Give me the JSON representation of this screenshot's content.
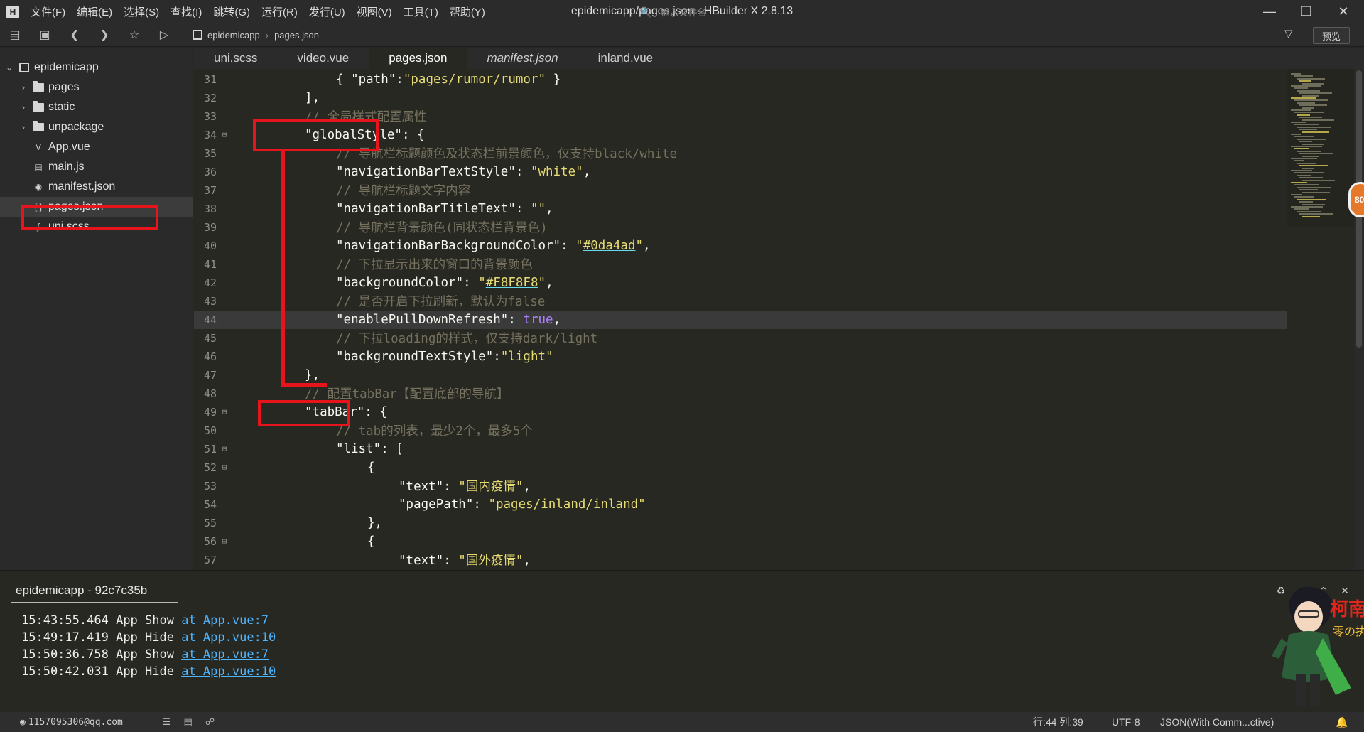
{
  "app": {
    "logo": "H",
    "title": "epidemicapp/pages.json - HBuilder X 2.8.13",
    "menu": [
      "文件(F)",
      "编辑(E)",
      "选择(S)",
      "查找(I)",
      "跳转(G)",
      "运行(R)",
      "发行(U)",
      "视图(V)",
      "工具(T)",
      "帮助(Y)"
    ]
  },
  "toolbar": {
    "breadcrumb": [
      "epidemicapp",
      "pages.json"
    ],
    "file_search_placeholder": "输入文件名",
    "preview_label": "预览"
  },
  "sidebar": {
    "project": "epidemicapp",
    "items": [
      {
        "label": "pages",
        "type": "folder"
      },
      {
        "label": "static",
        "type": "folder"
      },
      {
        "label": "unpackage",
        "type": "folder"
      },
      {
        "label": "App.vue",
        "type": "vue"
      },
      {
        "label": "main.js",
        "type": "js"
      },
      {
        "label": "manifest.json",
        "type": "manifest"
      },
      {
        "label": "pages.json",
        "type": "json"
      },
      {
        "label": "uni.scss",
        "type": "scss"
      }
    ]
  },
  "tabs": [
    {
      "label": "uni.scss"
    },
    {
      "label": "video.vue"
    },
    {
      "label": "pages.json"
    },
    {
      "label": "manifest.json"
    },
    {
      "label": "inland.vue"
    }
  ],
  "editor": {
    "line_numbers": [
      "31",
      "32",
      "33",
      "34",
      "35",
      "36",
      "37",
      "38",
      "39",
      "40",
      "41",
      "42",
      "43",
      "44",
      "45",
      "46",
      "47",
      "48",
      "49",
      "50",
      "51",
      "52",
      "53",
      "54",
      "55",
      "56",
      "57"
    ],
    "lines": [
      "{ \"path\":\"pages/rumor/rumor\" }",
      "],",
      "// 全局样式配置属性",
      "\"globalStyle\": {",
      "// 导航栏标题颜色及状态栏前景颜色，仅支持black/white",
      "\"navigationBarTextStyle\": \"white\",",
      "// 导航栏标题文字内容",
      "\"navigationBarTitleText\": \"\",",
      "// 导航栏背景颜色(同状态栏背景色)",
      "\"navigationBarBackgroundColor\": \"#0da4ad\",",
      "// 下拉显示出来的窗口的背景颜色",
      "\"backgroundColor\": \"#F8F8F8\",",
      "// 是否开启下拉刷新，默认为false",
      "\"enablePullDownRefresh\": true,",
      "// 下拉loading的样式，仅支持dark/light",
      "\"backgroundTextStyle\":\"light\"",
      "},",
      "// 配置tabBar【配置底部的导航】",
      "\"tabBar\": {",
      "// tab的列表，最少2个，最多5个",
      "\"list\": [",
      "{",
      "\"text\": \"国内疫情\",",
      "\"pagePath\": \"pages/inland/inland\"",
      "},",
      "{",
      "\"text\": \"国外疫情\","
    ]
  },
  "badge": "80",
  "console": {
    "tab_label": "epidemicapp - 92c7c35b",
    "logs": [
      {
        "time": "15:43:55.464",
        "msg": "App Show",
        "link": "at App.vue:7"
      },
      {
        "time": "15:49:17.419",
        "msg": "App Hide",
        "link": "at App.vue:10"
      },
      {
        "time": "15:50:36.758",
        "msg": "App Show",
        "link": "at App.vue:7"
      },
      {
        "time": "15:50:42.031",
        "msg": "App Hide",
        "link": "at App.vue:10"
      }
    ]
  },
  "status": {
    "account": "1157095306@qq.com",
    "position": "行:44  列:39",
    "encoding": "UTF-8",
    "language": "JSON(With Comm...ctive)"
  },
  "colors": {
    "highlight_box": "#e8141b",
    "string": "#e6db74",
    "comment": "#75715e",
    "boolean": "#ae81ff",
    "link": "#4fb5ff"
  }
}
